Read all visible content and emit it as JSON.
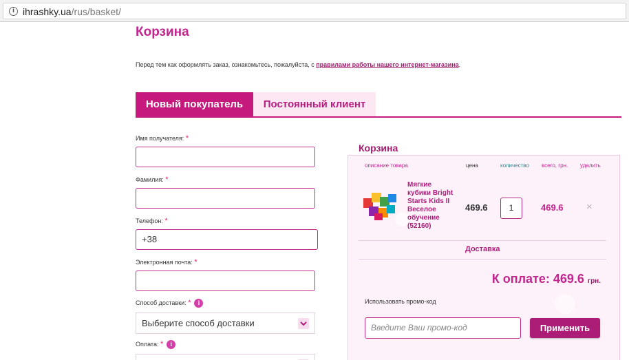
{
  "browser": {
    "url_domain": "ihrashky.ua",
    "url_path": "/rus/basket/"
  },
  "page": {
    "title": "Корзина",
    "notice_text": "Перед тем как оформлять заказ, ознакомьтесь, пожалуйста, с ",
    "notice_link": "правилами работы нашего интернет-магазина",
    "notice_end": "."
  },
  "tabs": [
    {
      "label": "Новый покупатель",
      "active": true
    },
    {
      "label": "Постоянный клиент",
      "active": false
    }
  ],
  "form": {
    "recipient_label": "Имя получателя:",
    "recipient_value": "",
    "lastname_label": "Фамилия:",
    "lastname_value": "",
    "phone_label": "Телефон:",
    "phone_value": "+38",
    "email_label": "Электронная почта:",
    "email_value": "",
    "delivery_label": "Способ доставки:",
    "delivery_value": "Выберите способ доставки",
    "payment_label": "Оплата:",
    "required_mark": "*"
  },
  "cart": {
    "title": "Корзина",
    "headers": {
      "description": "описание товара",
      "price": "цена",
      "quantity": "количество",
      "total": "всего, грн.",
      "remove": "удалить"
    },
    "item": {
      "name": "Мягкие кубики Bright Starts Kids II Веселое обучение (52160)",
      "price": "469.6",
      "quantity": "1",
      "total": "469.6",
      "remove_icon": "×"
    },
    "delivery_label": "Доставка",
    "total_label": "К оплате: 469.6",
    "total_currency": "грн.",
    "promo_label": "Использовать промо-код",
    "promo_placeholder": "Введите Ваш промо-код",
    "apply_button": "Применить"
  },
  "colors": {
    "brand": "#c5197d",
    "brand_dark": "#ab1d76",
    "tab_inactive_bg": "#fce7f3",
    "cart_bg": "#fdf2fa"
  }
}
